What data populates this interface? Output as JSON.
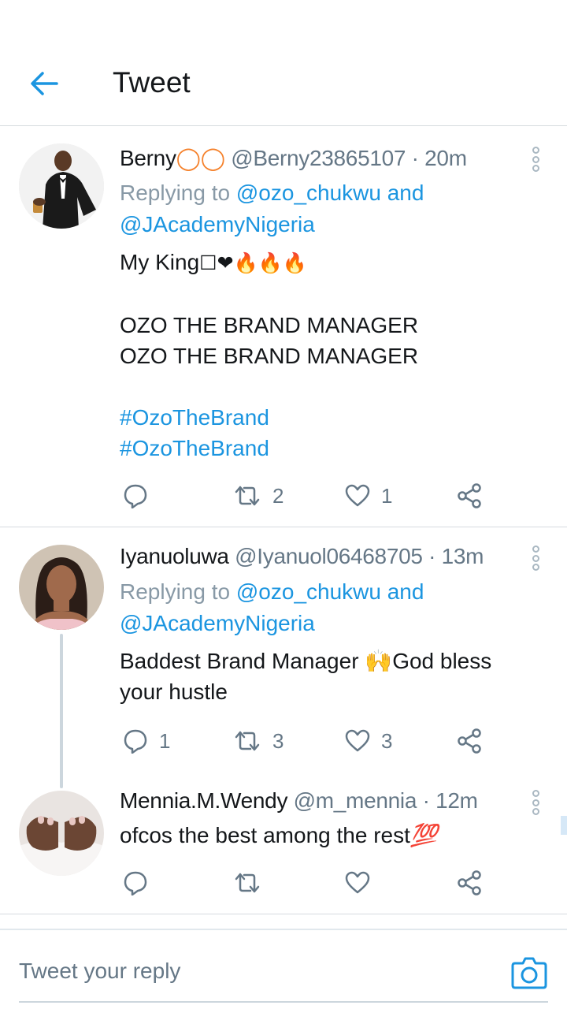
{
  "header": {
    "title": "Tweet",
    "back_icon": "arrow-left-icon",
    "accent": "#1b95e0"
  },
  "tweets": [
    {
      "name": "Berny",
      "name_suffix": "◯◯",
      "handle": "@Berny23865107",
      "time": "· 20m",
      "reply_prefix": "Replying to ",
      "reply_user1": "@ozo_chukwu",
      "reply_and": " and",
      "reply_user2": "@JAcademyNigeria",
      "text_line1": "My King",
      "emoji": "☐❤🔥🔥🔥",
      "text_line2": "OZO THE BRAND MANAGER",
      "text_line3": "OZO THE BRAND MANAGER",
      "hashtag1": "#OzoTheBrand",
      "hashtag2": "#OzoTheBrand",
      "replies": "",
      "retweets": "2",
      "likes": "1"
    },
    {
      "name": "Iyanuoluwa",
      "handle": "@Iyanuol06468705",
      "time": "· 13m",
      "reply_prefix": "Replying to ",
      "reply_user1": "@ozo_chukwu",
      "reply_and": " and",
      "reply_user2": "@JAcademyNigeria",
      "text_a": "Baddest Brand Manager ",
      "emoji": "🙌",
      "text_b": "God bless your hustle",
      "replies": "1",
      "retweets": "3",
      "likes": "3"
    },
    {
      "name": "Mennia.M.Wendy",
      "handle": "@m_mennia",
      "time": "· 12m",
      "text": "ofcos the best among the rest",
      "emoji": "💯",
      "replies": "",
      "retweets": "",
      "likes": ""
    }
  ],
  "composer": {
    "placeholder": "Tweet your reply",
    "camera_icon": "camera-icon"
  }
}
